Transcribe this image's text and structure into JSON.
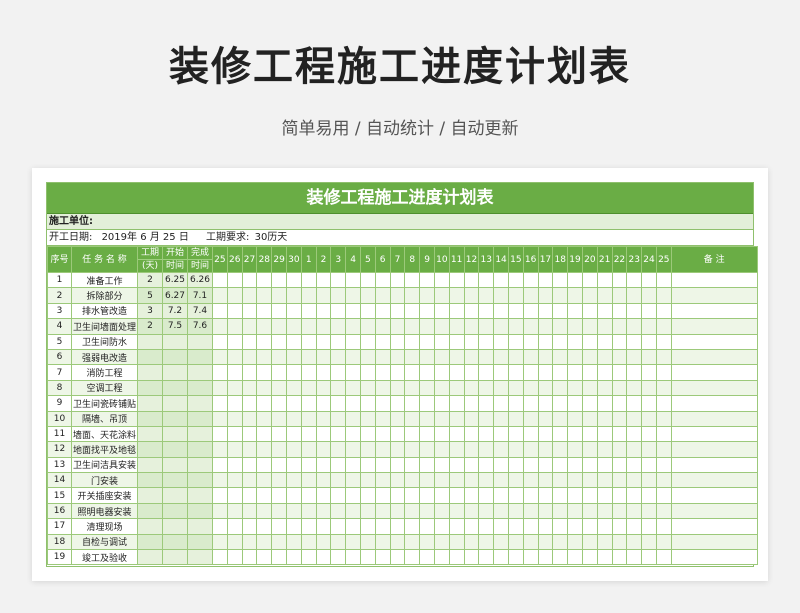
{
  "header": {
    "title": "装修工程施工进度计划表",
    "subtitle": "简单易用 / 自动统计 / 自动更新"
  },
  "sheet": {
    "title": "装修工程施工进度计划表",
    "unit_label": "施工单位:",
    "start_date_label": "开工日期:",
    "start_date_value": "2019年 6 月  25  日",
    "requirement_label": "工期要求:",
    "requirement_value": "30历天"
  },
  "columns": {
    "index": "序号",
    "task": "任 务 名 称",
    "duration_top": "工期",
    "duration_bottom": "(天)",
    "start_top": "开始",
    "start_bottom": "时间",
    "end_top": "完成",
    "end_bottom": "时间",
    "remark": "备    注"
  },
  "days": [
    "25",
    "26",
    "27",
    "28",
    "29",
    "30",
    "1",
    "2",
    "3",
    "4",
    "5",
    "6",
    "7",
    "8",
    "9",
    "10",
    "11",
    "12",
    "13",
    "14",
    "15",
    "16",
    "17",
    "18",
    "19",
    "20",
    "21",
    "22",
    "23",
    "24",
    "25"
  ],
  "tasks": [
    {
      "no": "1",
      "name": "准备工作",
      "duration": "2",
      "start": "6.25",
      "end": "6.26"
    },
    {
      "no": "2",
      "name": "拆除部分",
      "duration": "5",
      "start": "6.27",
      "end": "7.1"
    },
    {
      "no": "3",
      "name": "排水管改造",
      "duration": "3",
      "start": "7.2",
      "end": "7.4"
    },
    {
      "no": "4",
      "name": "卫生间墙面处理",
      "duration": "2",
      "start": "7.5",
      "end": "7.6"
    },
    {
      "no": "5",
      "name": "卫生间防水",
      "duration": "",
      "start": "",
      "end": ""
    },
    {
      "no": "6",
      "name": "强弱电改造",
      "duration": "",
      "start": "",
      "end": ""
    },
    {
      "no": "7",
      "name": "消防工程",
      "duration": "",
      "start": "",
      "end": ""
    },
    {
      "no": "8",
      "name": "空调工程",
      "duration": "",
      "start": "",
      "end": ""
    },
    {
      "no": "9",
      "name": "卫生间瓷砖铺贴",
      "duration": "",
      "start": "",
      "end": ""
    },
    {
      "no": "10",
      "name": "隔墙、吊顶",
      "duration": "",
      "start": "",
      "end": ""
    },
    {
      "no": "11",
      "name": "墙面、天花涂料",
      "duration": "",
      "start": "",
      "end": ""
    },
    {
      "no": "12",
      "name": "地面找平及地毯",
      "duration": "",
      "start": "",
      "end": ""
    },
    {
      "no": "13",
      "name": "卫生间洁具安装",
      "duration": "",
      "start": "",
      "end": ""
    },
    {
      "no": "14",
      "name": "门安装",
      "duration": "",
      "start": "",
      "end": ""
    },
    {
      "no": "15",
      "name": "开关插座安装",
      "duration": "",
      "start": "",
      "end": ""
    },
    {
      "no": "16",
      "name": "照明电器安装",
      "duration": "",
      "start": "",
      "end": ""
    },
    {
      "no": "17",
      "name": "清理现场",
      "duration": "",
      "start": "",
      "end": ""
    },
    {
      "no": "18",
      "name": "自检与调试",
      "duration": "",
      "start": "",
      "end": ""
    },
    {
      "no": "19",
      "name": "竣工及验收",
      "duration": "",
      "start": "",
      "end": ""
    }
  ],
  "colors": {
    "accent": "#6aad45",
    "grid_line": "#9cc97a",
    "row_alt": "#eef6e7"
  }
}
